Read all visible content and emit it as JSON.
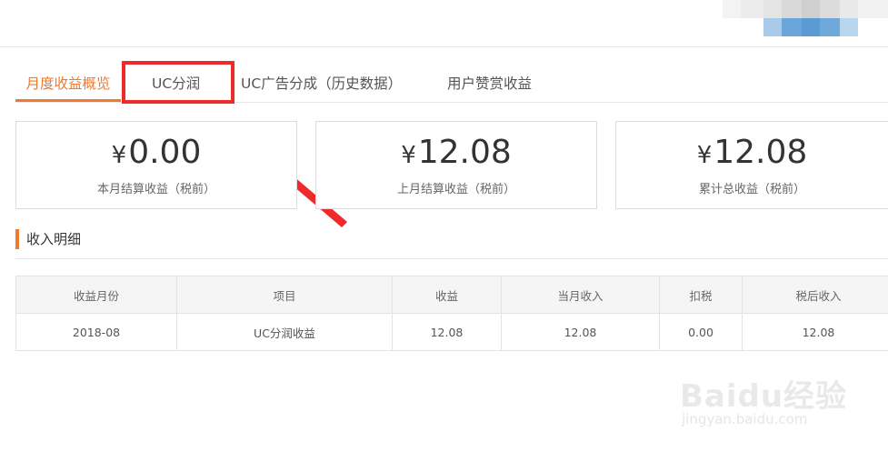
{
  "tabs": [
    {
      "label": "月度收益概览",
      "active": true
    },
    {
      "label": "UC分润",
      "active": false
    },
    {
      "label": "UC广告分成（历史数据）",
      "active": false
    },
    {
      "label": "用户赞赏收益",
      "active": false
    }
  ],
  "summary_cards": [
    {
      "currency": "¥",
      "amount": "0.00",
      "label": "本月结算收益（税前）"
    },
    {
      "currency": "¥",
      "amount": "12.08",
      "label": "上月结算收益（税前）"
    },
    {
      "currency": "¥",
      "amount": "12.08",
      "label": "累计总收益（税前）"
    }
  ],
  "section": {
    "title": "收入明细"
  },
  "table": {
    "headers": [
      "收益月份",
      "项目",
      "收益",
      "当月收入",
      "扣税",
      "税后收入"
    ],
    "rows": [
      [
        "2018-08",
        "UC分润收益",
        "12.08",
        "12.08",
        "0.00",
        "12.08"
      ]
    ]
  },
  "watermark": {
    "brand": "Baidu经验",
    "url": "jingyan.baidu.com"
  },
  "colors": {
    "accent": "#f07a2e",
    "annotation_red": "#ee2a2a"
  }
}
